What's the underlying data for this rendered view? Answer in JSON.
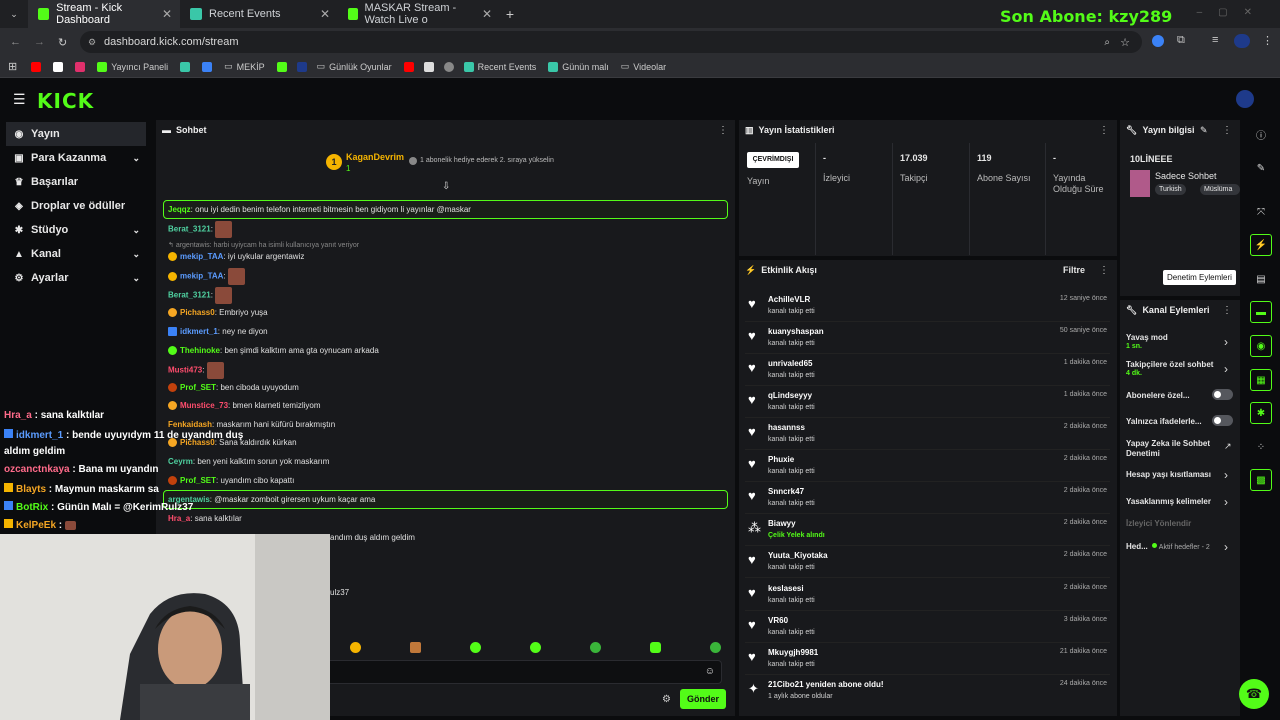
{
  "browser": {
    "tabs": [
      {
        "label": "Stream - Kick Dashboard"
      },
      {
        "label": "Recent Events"
      },
      {
        "label": "MASKAR Stream - Watch Live o"
      }
    ],
    "url": "dashboard.kick.com/stream",
    "overlay_title": "Son Abone: kzy289",
    "bookmarks": [
      "Yayıncı Paneli",
      "MEKİP",
      "Günlük Oyunlar",
      "Recent Events",
      "Günün malı",
      "Videolar"
    ]
  },
  "sidebar": {
    "items": [
      {
        "label": "Yayın",
        "icon": "broadcast-icon"
      },
      {
        "label": "Para Kazanma",
        "icon": "money-icon"
      },
      {
        "label": "Başarılar",
        "icon": "trophy-icon"
      },
      {
        "label": "Droplar ve ödüller",
        "icon": "gift-icon"
      },
      {
        "label": "Stüdyo",
        "icon": "studio-icon"
      },
      {
        "label": "Kanal",
        "icon": "channel-icon"
      },
      {
        "label": "Ayarlar",
        "icon": "gear-icon"
      }
    ]
  },
  "chat": {
    "title": "Sohbet",
    "gifter": "KaganDevrim",
    "gifter_count": "1",
    "gift_text": "1 abonelik hediye ederek 2. sıraya yükselin",
    "messages": [
      {
        "user": "Jeqqz",
        "text": "onu iyi dedin benim telefon interneti bitmesin ben gidiyom li yayınlar @maskar",
        "color": "#53fc18"
      },
      {
        "user": "Berat_3121",
        "text": "",
        "color": "#4fd1a0"
      },
      {
        "user": "",
        "text": "argentawis: harbi uyiycam ha isimli kullanıcıya yanıt veriyor",
        "color": "#888"
      },
      {
        "user": "mekip_TAA",
        "text": "iyi uykular argentawiz",
        "color": "#5b9cff"
      },
      {
        "user": "mekip_TAA",
        "text": "",
        "color": "#5b9cff"
      },
      {
        "user": "Berat_3121",
        "text": "",
        "color": "#4fd1a0"
      },
      {
        "user": "Pichass0",
        "text": "Embriyo yuşa",
        "color": "#f5a623"
      },
      {
        "user": "idkmert_1",
        "text": "ney ne diyon",
        "color": "#5b9cff"
      },
      {
        "user": "Thehinoke",
        "text": "ben şimdi kalktım ama gta oynucam arkada",
        "color": "#53fc18"
      },
      {
        "user": "Musti473",
        "text": "",
        "color": "#ff4d6d"
      },
      {
        "user": "Prof_SET",
        "text": "ben ciboda uyuyodum",
        "color": "#53fc18"
      },
      {
        "user": "Munstice_73",
        "text": "bmen klarneti temizliyom",
        "color": "#ff4d6d"
      },
      {
        "user": "Fenkaidash",
        "text": "maskarım hani küfürü bırakmıştın",
        "color": "#f5a623"
      },
      {
        "user": "Pichass0",
        "text": "Sana kaldırdık kürkan",
        "color": "#f5a623"
      },
      {
        "user": "Ceyrm",
        "text": "ben yeni kalktım sorun yok maskarım",
        "color": "#4fd1a0"
      },
      {
        "user": "Prof_SET",
        "text": "uyandım cibo kapattı",
        "color": "#53fc18"
      },
      {
        "user": "argentawis",
        "text": "@maskar zomboit girersen uykum kaçar ama",
        "color": "#4fd1a0"
      },
      {
        "user": "Hra_a",
        "text": "sana kalktılar",
        "color": "#ff4d6d"
      },
      {
        "user": "",
        "text": "andım duş aldım geldim",
        "color": "#e0e0e0"
      },
      {
        "user": "",
        "text": "ulz37",
        "color": "#e0e0e0"
      }
    ],
    "send_label": "Gönder"
  },
  "overlay_chat": [
    {
      "user": "Hra_a",
      "text": " : sana kalktılar",
      "color": "#ff6b8a"
    },
    {
      "user": "idkmert_1",
      "text": " : bende uyuyıdym 11 de uyandım duş",
      "color": "#5b9cff"
    },
    {
      "user": "",
      "text": "aldım geldim",
      "color": "#fff"
    },
    {
      "user": "ozcanctnkaya",
      "text": " : Bana mı uyandın",
      "color": "#ff6b8a"
    },
    {
      "user": "Blayts",
      "text": " : Maymun maskarım sa",
      "color": "#f5a623"
    },
    {
      "user": "BotRix",
      "text": " : Günün Malı = @KerimRulz37",
      "color": "#53fc18"
    },
    {
      "user": "KelPeEk",
      "text": " : ",
      "color": "#f5a623"
    }
  ],
  "stats": {
    "title": "Yayın İstatistikleri",
    "status": "ÇEVRİMDIŞI",
    "status_label": "Yayın",
    "viewers": "-",
    "viewers_label": "İzleyici",
    "followers": "17.039",
    "followers_label": "Takipçi",
    "subs": "119",
    "subs_label": "Abone Sayısı",
    "uptime": "-",
    "uptime_label": "Yayında Olduğu Süre"
  },
  "activity": {
    "title": "Etkinlik Akışı",
    "filter": "Filtre",
    "events": [
      {
        "name": "AchilleVLR",
        "sub": "kanalı takip etti",
        "time": "12 saniye önce",
        "icon": "heart-icon"
      },
      {
        "name": "kuanyshaspan",
        "sub": "kanalı takip etti",
        "time": "50 saniye önce",
        "icon": "heart-icon"
      },
      {
        "name": "unrivaled65",
        "sub": "kanalı takip etti",
        "time": "1 dakika önce",
        "icon": "heart-icon"
      },
      {
        "name": "qLindseyyy",
        "sub": "kanalı takip etti",
        "time": "1 dakika önce",
        "icon": "heart-icon"
      },
      {
        "name": "hasannss",
        "sub": "kanalı takip etti",
        "time": "2 dakika önce",
        "icon": "heart-icon"
      },
      {
        "name": "Phuxie",
        "sub": "kanalı takip etti",
        "time": "2 dakika önce",
        "icon": "heart-icon"
      },
      {
        "name": "Snncrk47",
        "sub": "kanalı takip etti",
        "time": "2 dakika önce",
        "icon": "heart-icon"
      },
      {
        "name": "Biawyy",
        "sub": "Çelik Yelek alındı",
        "time": "2 dakika önce",
        "icon": "reward-icon"
      },
      {
        "name": "Yuuta_Kiyotaka",
        "sub": "kanalı takip etti",
        "time": "2 dakika önce",
        "icon": "heart-icon"
      },
      {
        "name": "keslasesi",
        "sub": "kanalı takip etti",
        "time": "2 dakika önce",
        "icon": "heart-icon"
      },
      {
        "name": "VR60",
        "sub": "kanalı takip etti",
        "time": "3 dakika önce",
        "icon": "heart-icon"
      },
      {
        "name": "Mkuygjh9981",
        "sub": "kanalı takip etti",
        "time": "21 dakika önce",
        "icon": "heart-icon"
      },
      {
        "name": "21Cibo21 yeniden abone oldu!",
        "sub": "1 aylık abone oldular",
        "time": "24 dakika önce",
        "icon": "sparkle-icon"
      }
    ]
  },
  "stream_info": {
    "title": "Yayın bilgisi",
    "stream_title": "10LİNEEE",
    "category": "Sadece Sohbet",
    "tags": [
      "Turkish",
      "Müslüma"
    ]
  },
  "tooltip": "Denetim Eylemleri",
  "channel_actions": {
    "title": "Kanal Eylemleri",
    "items": [
      {
        "label": "Yavaş mod",
        "value": "1 sn."
      },
      {
        "label": "Takipçilere özel sohbet",
        "value": "4 dk."
      },
      {
        "label": "Abonelere özel...",
        "value": ""
      },
      {
        "label": "Yalnızca ifadelerle...",
        "value": ""
      },
      {
        "label": "Yapay Zeka ile Sohbet Denetimi",
        "value": ""
      },
      {
        "label": "Hesap yaşı kısıtlaması",
        "value": ""
      },
      {
        "label": "Yasaklanmış kelimeler",
        "value": ""
      },
      {
        "label": "İzleyici Yönlendir",
        "value": ""
      },
      {
        "label": "Hed...",
        "value": "Aktif hedefler - 2"
      }
    ]
  }
}
